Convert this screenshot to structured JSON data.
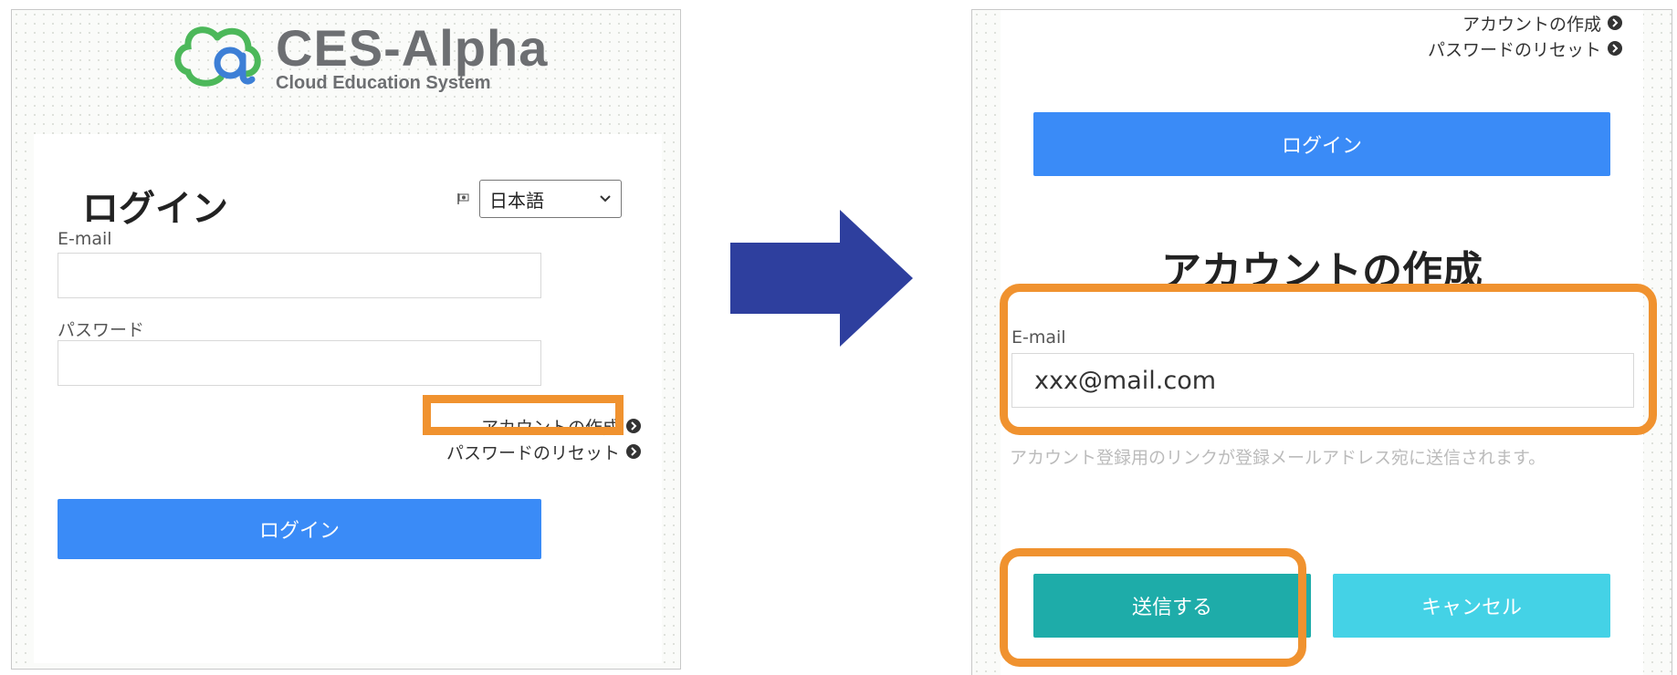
{
  "colors": {
    "primary_button": "#3a8bf7",
    "send_button": "#1eaca9",
    "cancel_button": "#44d2e6",
    "highlight": "#f0922f",
    "arrow": "#2e3f9e",
    "logo_blue": "#3d7fd6",
    "logo_green": "#4cb85a"
  },
  "left_screen": {
    "logo": {
      "title": "CES-Alpha",
      "subtitle": "Cloud Education System",
      "icon": "cloud-logo-icon"
    },
    "heading": "ログイン",
    "language": {
      "icon": "flag-icon",
      "selected": "日本語"
    },
    "email_label": "E-mail",
    "email_value": "",
    "password_label": "パスワード",
    "password_value": "",
    "create_account_link": "アカウントの作成",
    "reset_password_link": "パスワードのリセット",
    "link_icon": "circle-chevron-right-icon",
    "login_button": "ログイン"
  },
  "arrow": {
    "icon": "right-arrow-icon"
  },
  "right_screen": {
    "create_account_link": "アカウントの作成",
    "reset_password_link": "パスワードのリセット",
    "login_button": "ログイン",
    "heading": "アカウントの作成",
    "email_label": "E-mail",
    "email_value": "xxx@mail.com",
    "help_text": "アカウント登録用のリンクが登録メールアドレス宛に送信されます。",
    "send_button": "送信する",
    "cancel_button": "キャンセル"
  }
}
